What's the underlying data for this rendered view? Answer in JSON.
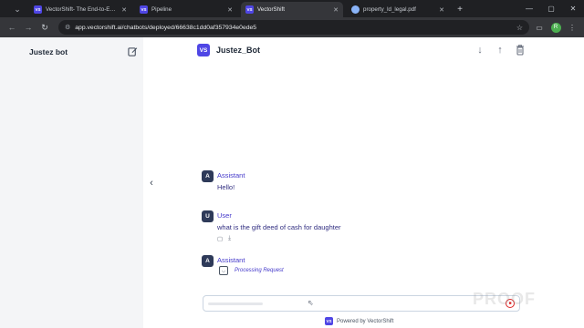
{
  "browser": {
    "tabs": [
      {
        "label": "VectorShift- The End-to-End AI",
        "favicon": "VS",
        "active": false
      },
      {
        "label": "Pipeline",
        "favicon": "VS",
        "active": false
      },
      {
        "label": "VectorShift",
        "favicon": "VS",
        "active": true
      },
      {
        "label": "property_ld_legal.pdf",
        "favicon": "doc",
        "active": false
      }
    ],
    "url": "app.vectorshift.ai/chatbots/deployed/66638c1dd0af357934e0ede5",
    "profile_initial": "R"
  },
  "sidebar": {
    "title": "Justez bot"
  },
  "chat": {
    "bot_name": "Justez_Bot",
    "logo_text": "VS",
    "messages": [
      {
        "avatar": "A",
        "sender": "Assistant",
        "text": "Hello!"
      },
      {
        "avatar": "U",
        "sender": "User",
        "text": "what is the gift deed of cash for daughter"
      },
      {
        "avatar": "A",
        "sender": "Assistant",
        "status": "Processing Request"
      }
    ],
    "input": {
      "value": "",
      "placeholder": ""
    },
    "powered_by": "Powered by VectorShift",
    "watermark": "PROOF"
  },
  "colors": {
    "brand": "#4f46e5",
    "avatar": "#2e3a59",
    "sender_text": "#4338ca",
    "stop_button": "#dc2626"
  }
}
